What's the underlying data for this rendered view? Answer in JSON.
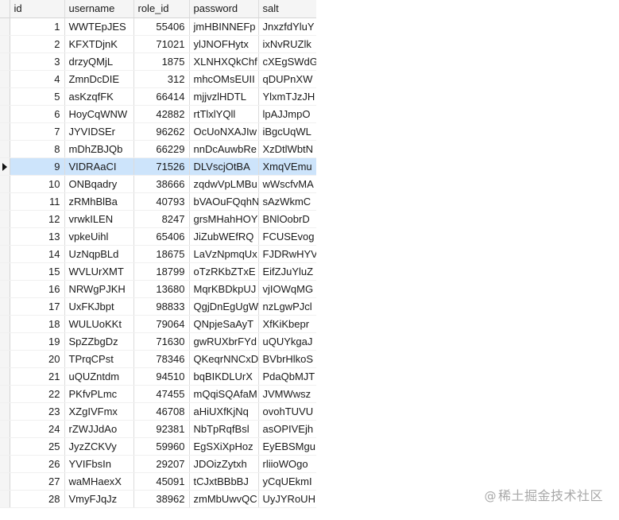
{
  "grid": {
    "columns": [
      "id",
      "username",
      "role_id",
      "password",
      "salt"
    ],
    "selected_row_id": "9",
    "rows": [
      {
        "id": "1",
        "username": "WWTEpJES",
        "role_id": "55406",
        "password": "jmHBINNEFp",
        "salt": "JnxzfdYluY"
      },
      {
        "id": "2",
        "username": "KFXTDjnK",
        "role_id": "71021",
        "password": "ylJNOFHytx",
        "salt": "ixNvRUZlk"
      },
      {
        "id": "3",
        "username": "drzyQMjL",
        "role_id": "1875",
        "password": "XLNHXQkChf",
        "salt": "cXEgSWdG"
      },
      {
        "id": "4",
        "username": "ZmnDcDIE",
        "role_id": "312",
        "password": "mhcOMsEUII",
        "salt": "qDUPnXW"
      },
      {
        "id": "5",
        "username": "asKzqfFK",
        "role_id": "66414",
        "password": "mjjvzlHDTL",
        "salt": "YlxmTJzJH"
      },
      {
        "id": "6",
        "username": "HoyCqWNW",
        "role_id": "42882",
        "password": "rtTlxlYQll",
        "salt": "lpAJJmpO"
      },
      {
        "id": "7",
        "username": "JYVIDSEr",
        "role_id": "96262",
        "password": "OcUoNXAJIw",
        "salt": "iBgcUqWL"
      },
      {
        "id": "8",
        "username": "mDhZBJQb",
        "role_id": "66229",
        "password": "nnDcAuwbRe",
        "salt": "XzDtlWbtN"
      },
      {
        "id": "9",
        "username": "VIDRAaCI",
        "role_id": "71526",
        "password": "DLVscjOtBA",
        "salt": "XmqVEmu"
      },
      {
        "id": "10",
        "username": "ONBqadry",
        "role_id": "38666",
        "password": "zqdwVpLMBu",
        "salt": "wWscfvMA"
      },
      {
        "id": "11",
        "username": "zRMhBlBa",
        "role_id": "40793",
        "password": "bVAOuFQqhN",
        "salt": "sAzWkmC"
      },
      {
        "id": "12",
        "username": "vrwkILEN",
        "role_id": "8247",
        "password": "grsMHahHOY",
        "salt": "BNlOobrD"
      },
      {
        "id": "13",
        "username": "vpkeUihl",
        "role_id": "65406",
        "password": "JiZubWEfRQ",
        "salt": "FCUSEvog"
      },
      {
        "id": "14",
        "username": "UzNqpBLd",
        "role_id": "18675",
        "password": "LaVzNpmqUx",
        "salt": "FJDRwHYV"
      },
      {
        "id": "15",
        "username": "WVLUrXMT",
        "role_id": "18799",
        "password": "oTzRKbZTxE",
        "salt": "EifZJuYluZ"
      },
      {
        "id": "16",
        "username": "NRWgPJKH",
        "role_id": "13680",
        "password": "MqrKBDkpUJ",
        "salt": "vjIOWqMG"
      },
      {
        "id": "17",
        "username": "UxFKJbpt",
        "role_id": "98833",
        "password": "QgjDnEgUgW",
        "salt": "nzLgwPJcl"
      },
      {
        "id": "18",
        "username": "WULUoKKt",
        "role_id": "79064",
        "password": "QNpjeSaAyT",
        "salt": "XfKiKbepr"
      },
      {
        "id": "19",
        "username": "SpZZbgDz",
        "role_id": "71630",
        "password": "gwRUXbrFYd",
        "salt": "uQUYkgaJ"
      },
      {
        "id": "20",
        "username": "TPrqCPst",
        "role_id": "78346",
        "password": "QKeqrNNCxD",
        "salt": "BVbrHlkoS"
      },
      {
        "id": "21",
        "username": "uQUZntdm",
        "role_id": "94510",
        "password": "bqBIKDLUrX",
        "salt": "PdaQbMJT"
      },
      {
        "id": "22",
        "username": "PKfvPLmc",
        "role_id": "47455",
        "password": "mQqiSQAfaM",
        "salt": "JVMWwsz"
      },
      {
        "id": "23",
        "username": "XZgIVFmx",
        "role_id": "46708",
        "password": "aHiUXfKjNq",
        "salt": "ovohTUVU"
      },
      {
        "id": "24",
        "username": "rZWJJdAo",
        "role_id": "92381",
        "password": "NbTpRqfBsl",
        "salt": "asOPIVEjh"
      },
      {
        "id": "25",
        "username": "JyzZCKVy",
        "role_id": "59960",
        "password": "EgSXiXpHoz",
        "salt": "EyEBSMgu"
      },
      {
        "id": "26",
        "username": "YVIFbsIn",
        "role_id": "29207",
        "password": "JDOizZytxh",
        "salt": "rliioWOgo"
      },
      {
        "id": "27",
        "username": "waMHaexX",
        "role_id": "45091",
        "password": "tCJxtBBbBJ",
        "salt": "yCqUEkmI"
      },
      {
        "id": "28",
        "username": "VmyFJqJz",
        "role_id": "38962",
        "password": "zmMbUwvQC",
        "salt": "UyJYRoUH"
      }
    ]
  },
  "watermark": {
    "at": "@",
    "text": "稀土掘金技术社区"
  }
}
